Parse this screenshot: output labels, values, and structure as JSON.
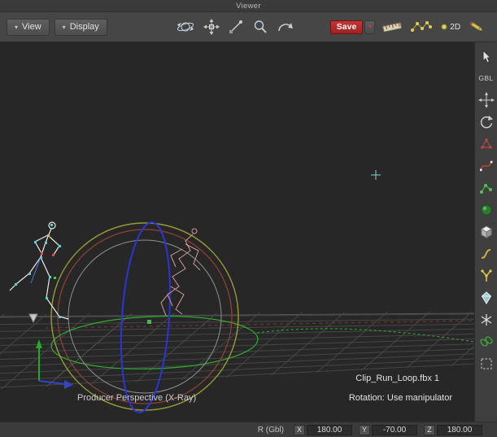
{
  "window": {
    "title": "Viewer"
  },
  "toolbar": {
    "view_label": "View",
    "display_label": "Display",
    "save_label": "Save",
    "twod_label": "2D"
  },
  "right_toolbar": {
    "gbl_label": "GBL"
  },
  "viewport": {
    "camera_label": "Producer Perspective (X-Ray)",
    "clip_label": "Clip_Run_Loop.fbx 1",
    "rotation_label": "Rotation: Use manipulator"
  },
  "statusbar": {
    "mode_label": "R (Gbl)",
    "fields": [
      {
        "axis": "X",
        "value": "180.00"
      },
      {
        "axis": "Y",
        "value": "-70.00"
      },
      {
        "axis": "Z",
        "value": "180.00"
      }
    ]
  },
  "colors": {
    "save_red": "#b03030",
    "manipulator_yellow": "#9a9a35",
    "manipulator_red": "#a03a2a",
    "manipulator_blue": "#2a35d6",
    "manipulator_green": "#2fae2f"
  }
}
